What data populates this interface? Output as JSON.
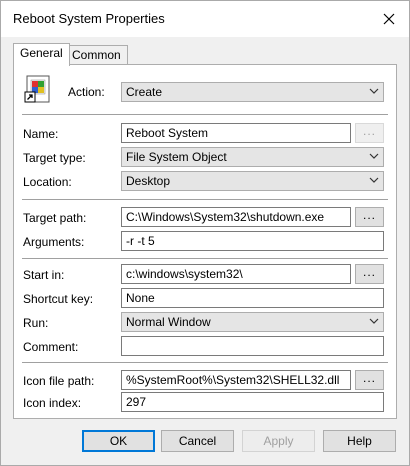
{
  "window": {
    "title": "Reboot System Properties"
  },
  "tabs": [
    {
      "label": "General"
    },
    {
      "label": "Common"
    }
  ],
  "action": {
    "label": "Action:",
    "value": "Create"
  },
  "name": {
    "label": "Name:",
    "value": "Reboot System"
  },
  "target_type": {
    "label": "Target type:",
    "value": "File System Object"
  },
  "location": {
    "label": "Location:",
    "value": "Desktop"
  },
  "target_path": {
    "label": "Target path:",
    "value": "C:\\Windows\\System32\\shutdown.exe"
  },
  "arguments": {
    "label": "Arguments:",
    "value": "-r -t 5"
  },
  "start_in": {
    "label": "Start in:",
    "value": "c:\\windows\\system32\\"
  },
  "shortcut_key": {
    "label": "Shortcut key:",
    "value": "None"
  },
  "run": {
    "label": "Run:",
    "value": "Normal Window"
  },
  "comment": {
    "label": "Comment:",
    "value": ""
  },
  "icon_file_path": {
    "label": "Icon file path:",
    "value": "%SystemRoot%\\System32\\SHELL32.dll"
  },
  "icon_index": {
    "label": "Icon index:",
    "value": "297"
  },
  "browse_label": "...",
  "buttons": {
    "ok": "OK",
    "cancel": "Cancel",
    "apply": "Apply",
    "help": "Help"
  },
  "icons": {
    "close": "close-icon",
    "shortcut": "shortcut-icon",
    "chevron": "chevron-down-icon"
  }
}
